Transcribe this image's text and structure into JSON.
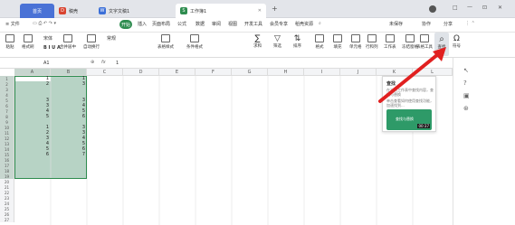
{
  "titlebar": {
    "tabs": [
      {
        "label": "首页",
        "icon": "home-icon"
      },
      {
        "label": "稿壳",
        "icon": "docer-icon"
      },
      {
        "label": "文字文稿1",
        "icon": "doc-icon"
      },
      {
        "label": "工作簿1",
        "icon": "sheet-icon"
      }
    ],
    "add_tab": "+",
    "window_controls": [
      "□",
      "—",
      "⊡",
      "✕"
    ]
  },
  "ribbon": {
    "menu": "≡ 文件",
    "tabs": [
      "开始",
      "插入",
      "页面布局",
      "公式",
      "数据",
      "审阅",
      "视图",
      "开发工具",
      "会员专享",
      "稻壳资源"
    ],
    "right": [
      "未保存",
      "协作",
      "分享"
    ]
  },
  "toolbar": {
    "left_group": [
      "粘贴",
      "格式刷"
    ],
    "font": "宋体",
    "buttons": [
      "合并居中",
      "自动换行",
      "常规",
      "表格样式",
      "条件格式",
      "求和",
      "筛选",
      "排序",
      "格式",
      "填充",
      "单元格",
      "行和列",
      "工作表",
      "冻结窗格",
      "表格工具",
      "查找",
      "符号"
    ]
  },
  "formula": {
    "cell_ref": "A1",
    "fx": "fx",
    "value": "1"
  },
  "columns": [
    "A",
    "B",
    "C",
    "D",
    "E",
    "F",
    "G",
    "H",
    "I",
    "J",
    "K",
    "L"
  ],
  "rows": [
    "1",
    "2",
    "3",
    "4",
    "5",
    "6",
    "7",
    "8",
    "9",
    "10",
    "11",
    "12",
    "13",
    "14",
    "15",
    "16",
    "17",
    "18",
    "19",
    "20",
    "21",
    "22",
    "23",
    "24",
    "25",
    "26",
    "27"
  ],
  "cells": {
    "A": [
      "1",
      "2",
      "",
      "",
      "3",
      "3",
      "4",
      "5",
      "",
      "1",
      "2",
      "3",
      "4",
      "5",
      "6"
    ],
    "B": [
      "1",
      "3",
      "",
      "",
      "3",
      "4",
      "5",
      "6",
      "",
      "3",
      "3",
      "4",
      "5",
      "6",
      "7"
    ]
  },
  "popup": {
    "title": "查找",
    "text1": "在当前工作表中查找内容，查找与替换",
    "text2": "单击查看如何使用查找功能，加速找到...",
    "video_label": "查找与替换",
    "video_time": "00:37"
  },
  "colors": {
    "accent_green": "#2e8c4f",
    "selection": "#b7d3c5",
    "arrow": "#e12020"
  }
}
